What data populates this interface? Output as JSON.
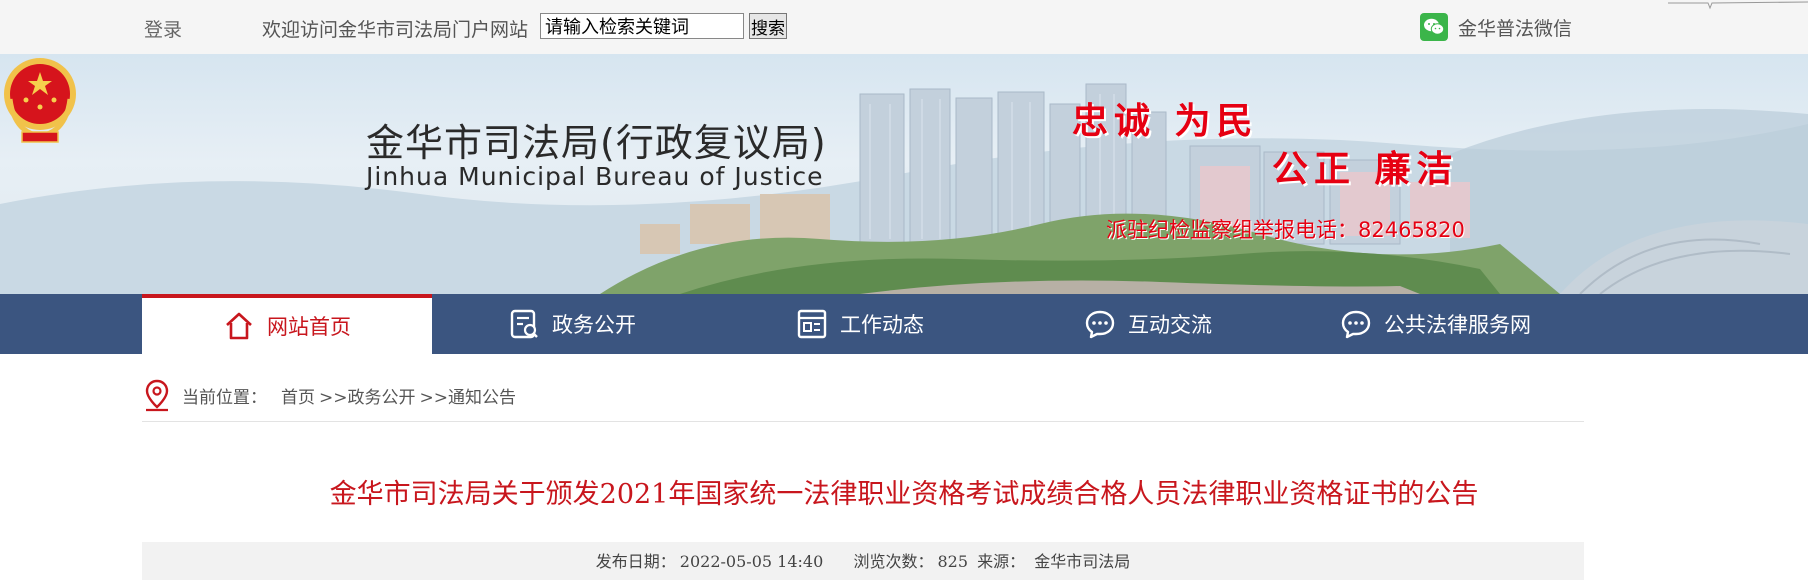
{
  "topbar": {
    "login": "登录",
    "welcome": "欢迎访问金华市司法局门户网站",
    "search_placeholder": "请输入检索关键词",
    "search_value": "请输入检索关键词",
    "search_button": "搜索",
    "wechat_label": "金华普法微信"
  },
  "banner": {
    "title_cn": "金华市司法局(行政复议局)",
    "title_en": "Jinhua Municipal Bureau of Justice",
    "slogan_line1": "忠诚 为民",
    "slogan_line2": "公正 廉洁",
    "report_text": "派驻纪检监察组举报电话：82465820"
  },
  "nav": {
    "items": [
      {
        "label": "网站首页",
        "icon": "home-icon",
        "active": true
      },
      {
        "label": "政务公开",
        "icon": "document-search-icon",
        "active": false
      },
      {
        "label": "工作动态",
        "icon": "news-icon",
        "active": false
      },
      {
        "label": "互动交流",
        "icon": "chat-icon",
        "active": false
      },
      {
        "label": "公共法律服务网",
        "icon": "chat-icon",
        "active": false
      }
    ]
  },
  "breadcrumb": {
    "prefix": "当前位置：",
    "items": [
      "首页",
      ">>政务公开",
      ">>通知公告"
    ]
  },
  "article": {
    "title": "金华市司法局关于颁发2021年国家统一法律职业资格考试成绩合格人员法律职业资格证书的公告",
    "date_label": "发布日期：",
    "date": "2022-05-05 14:40",
    "views_label": "浏览次数：",
    "views": "825",
    "source_label": "来源：",
    "source": "金华市司法局"
  },
  "colors": {
    "nav_bg": "#3b5580",
    "accent_red": "#c8161d",
    "slogan_red": "#e60012",
    "wechat_green": "#3bb54a"
  }
}
